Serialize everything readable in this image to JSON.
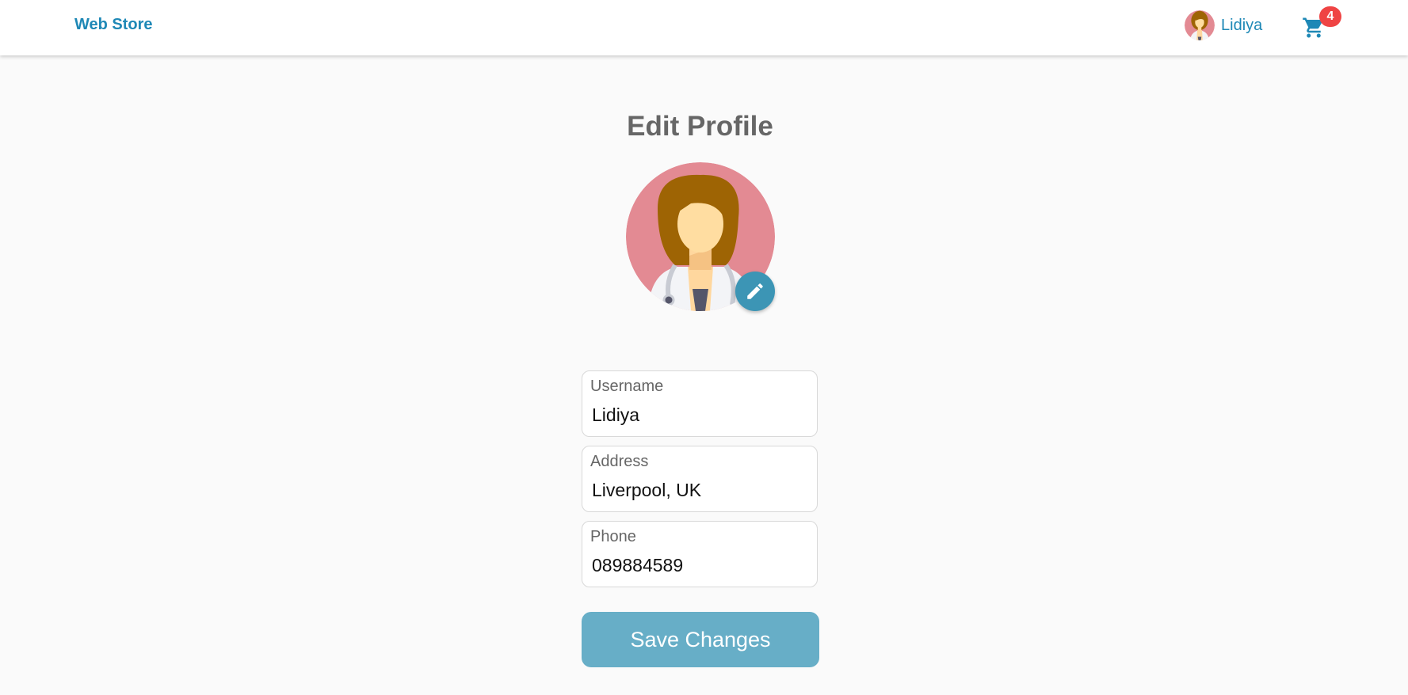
{
  "header": {
    "brand": "Web Store",
    "user_name": "Lidiya",
    "cart_count": "4"
  },
  "page": {
    "title": "Edit Profile"
  },
  "form": {
    "username": {
      "label": "Username",
      "value": "Lidiya"
    },
    "address": {
      "label": "Address",
      "value": "Liverpool, UK"
    },
    "phone": {
      "label": "Phone",
      "value": "089884589"
    },
    "save_label": "Save Changes"
  },
  "colors": {
    "brand": "#1e88b6",
    "badge": "#ef4444",
    "edit_button": "#3c95b5",
    "save_button": "#67aec7",
    "avatar_bg": "#e38a93"
  },
  "icons": {
    "cart": "shopping-cart-icon",
    "edit": "pencil-icon",
    "avatar": "doctor-avatar"
  }
}
